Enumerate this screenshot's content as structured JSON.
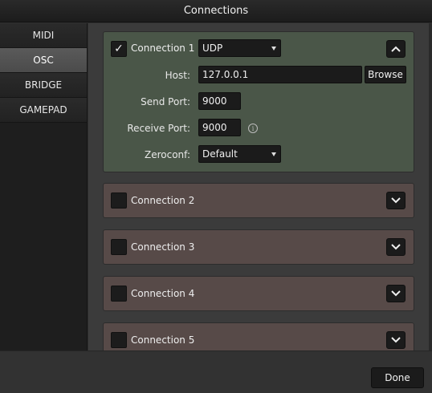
{
  "window": {
    "title": "Connections"
  },
  "sidebar": {
    "tabs": [
      {
        "label": "MIDI",
        "active": false
      },
      {
        "label": "OSC",
        "active": true
      },
      {
        "label": "BRIDGE",
        "active": false
      },
      {
        "label": "GAMEPAD",
        "active": false
      }
    ]
  },
  "connection1": {
    "label": "Connection 1",
    "checked": true,
    "check_glyph": "✓",
    "protocol": "UDP",
    "host_label": "Host:",
    "host_value": "127.0.0.1",
    "browse_label": "Browse",
    "send_port_label": "Send Port:",
    "send_port_value": "9000",
    "receive_port_label": "Receive Port:",
    "receive_port_value": "9000",
    "zeroconf_label": "Zeroconf:",
    "zeroconf_value": "Default",
    "info_glyph": "i"
  },
  "collapsed_connections": [
    {
      "label": "Connection 2",
      "checked": false
    },
    {
      "label": "Connection 3",
      "checked": false
    },
    {
      "label": "Connection 4",
      "checked": false
    },
    {
      "label": "Connection 5",
      "checked": false
    }
  ],
  "footer": {
    "done_label": "Done"
  },
  "colors": {
    "expanded_panel": "#4a5648",
    "collapsed_panel": "#574a48",
    "active_tab": "#5a5a5a"
  }
}
